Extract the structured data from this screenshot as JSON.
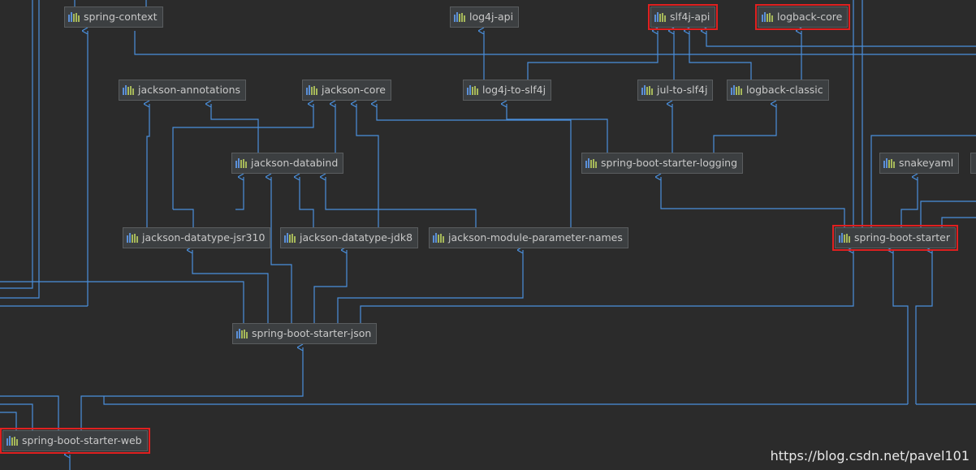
{
  "colors": {
    "background": "#2b2b2b",
    "edge": "#4a8fdc",
    "node_bg": "#3c3f41",
    "highlight": "#e02020"
  },
  "icon": "maven-bars-icon",
  "nodes": {
    "spring_context": "spring-context",
    "log4j_api": "log4j-api",
    "slf4j_api": "slf4j-api",
    "logback_core": "logback-core",
    "jackson_annotations": "jackson-annotations",
    "jackson_core": "jackson-core",
    "log4j_to_slf4j": "log4j-to-slf4j",
    "jul_to_slf4j": "jul-to-slf4j",
    "logback_classic": "logback-classic",
    "jackson_databind": "jackson-databind",
    "spring_boot_starter_logging": "spring-boot-starter-logging",
    "snakeyaml": "snakeyaml",
    "jackson_datatype_jsr310": "jackson-datatype-jsr310",
    "jackson_datatype_jdk8": "jackson-datatype-jdk8",
    "jackson_module_parameter_names": "jackson-module-parameter-names",
    "spring_boot_starter": "spring-boot-starter",
    "spring_boot_starter_json": "spring-boot-starter-json",
    "spring_boot_starter_web": "spring-boot-starter-web"
  },
  "highlighted": [
    "slf4j-api",
    "logback-core",
    "spring-boot-starter",
    "spring-boot-starter-web"
  ],
  "watermark": "https://blog.csdn.net/pavel101"
}
